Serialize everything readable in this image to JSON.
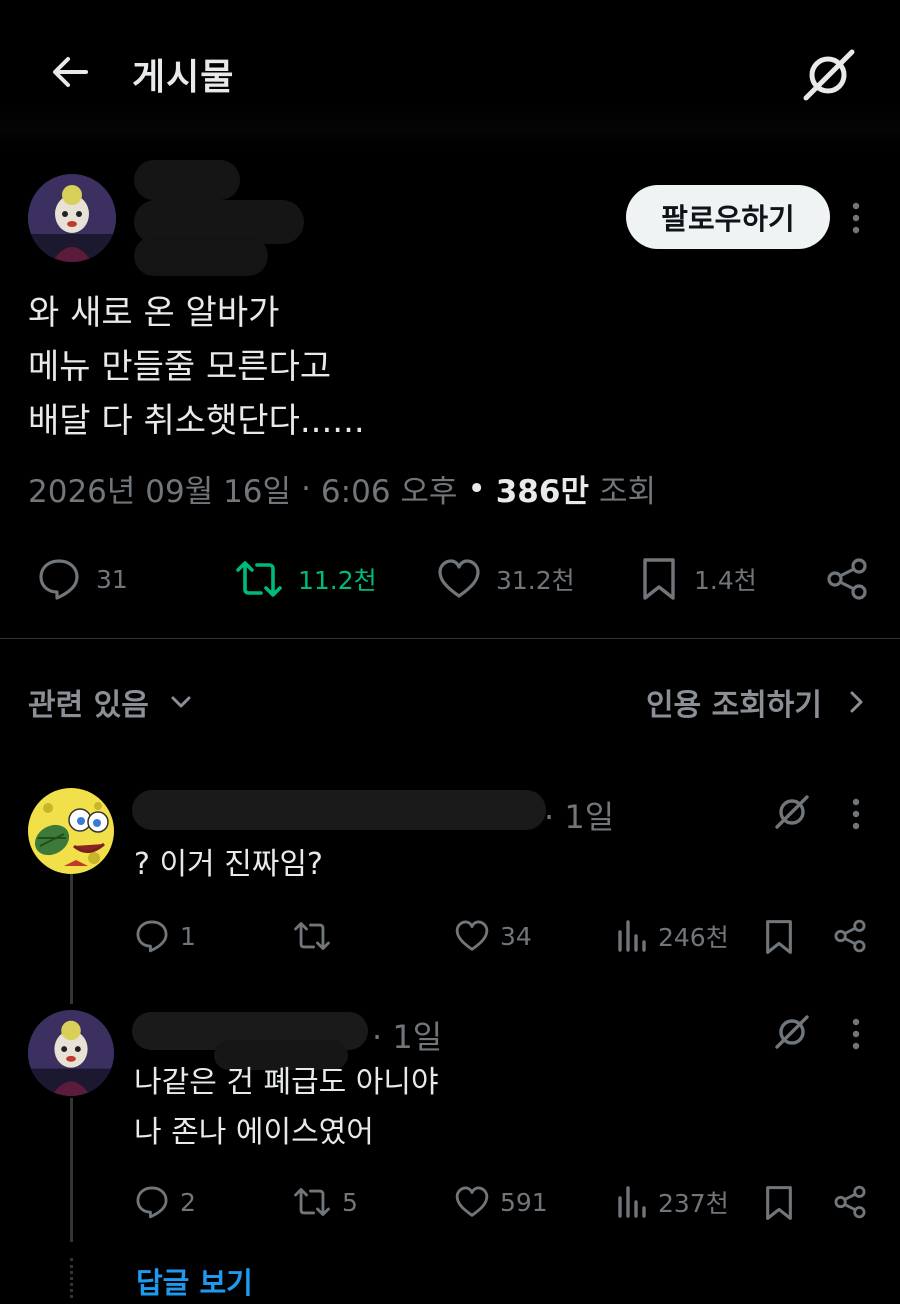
{
  "header": {
    "title": "게시물"
  },
  "post": {
    "follow_label": "팔로우하기",
    "text_lines": [
      "와 새로 온 알바가",
      "메뉴 만들줄 모른다고",
      "배달 다 취소햇단다......"
    ],
    "date": "2026년 09월 16일",
    "time": "6:06 오후",
    "views": "386만",
    "views_label": "조회",
    "stats": {
      "replies": "31",
      "reposts": "11.2천",
      "likes": "31.2천",
      "bookmarks": "1.4천"
    }
  },
  "related": {
    "label": "관련 있음",
    "quotes_label": "인용 조회하기"
  },
  "replies": [
    {
      "time": "1일",
      "text_lines": [
        "? 이거 진짜임?"
      ],
      "replies": "1",
      "reposts": "",
      "likes": "34",
      "views": "246천"
    },
    {
      "time": "1일",
      "text_lines": [
        "나같은 건 폐급도 아니야",
        "나 존나 에이스였어"
      ],
      "replies": "2",
      "reposts": "5",
      "likes": "591",
      "views": "237천"
    }
  ],
  "show_replies_label": "답글 보기",
  "colors": {
    "background": "#000000",
    "repost_green": "#00ba7c",
    "link_blue": "#1d9bf0",
    "muted": "#71767b"
  }
}
